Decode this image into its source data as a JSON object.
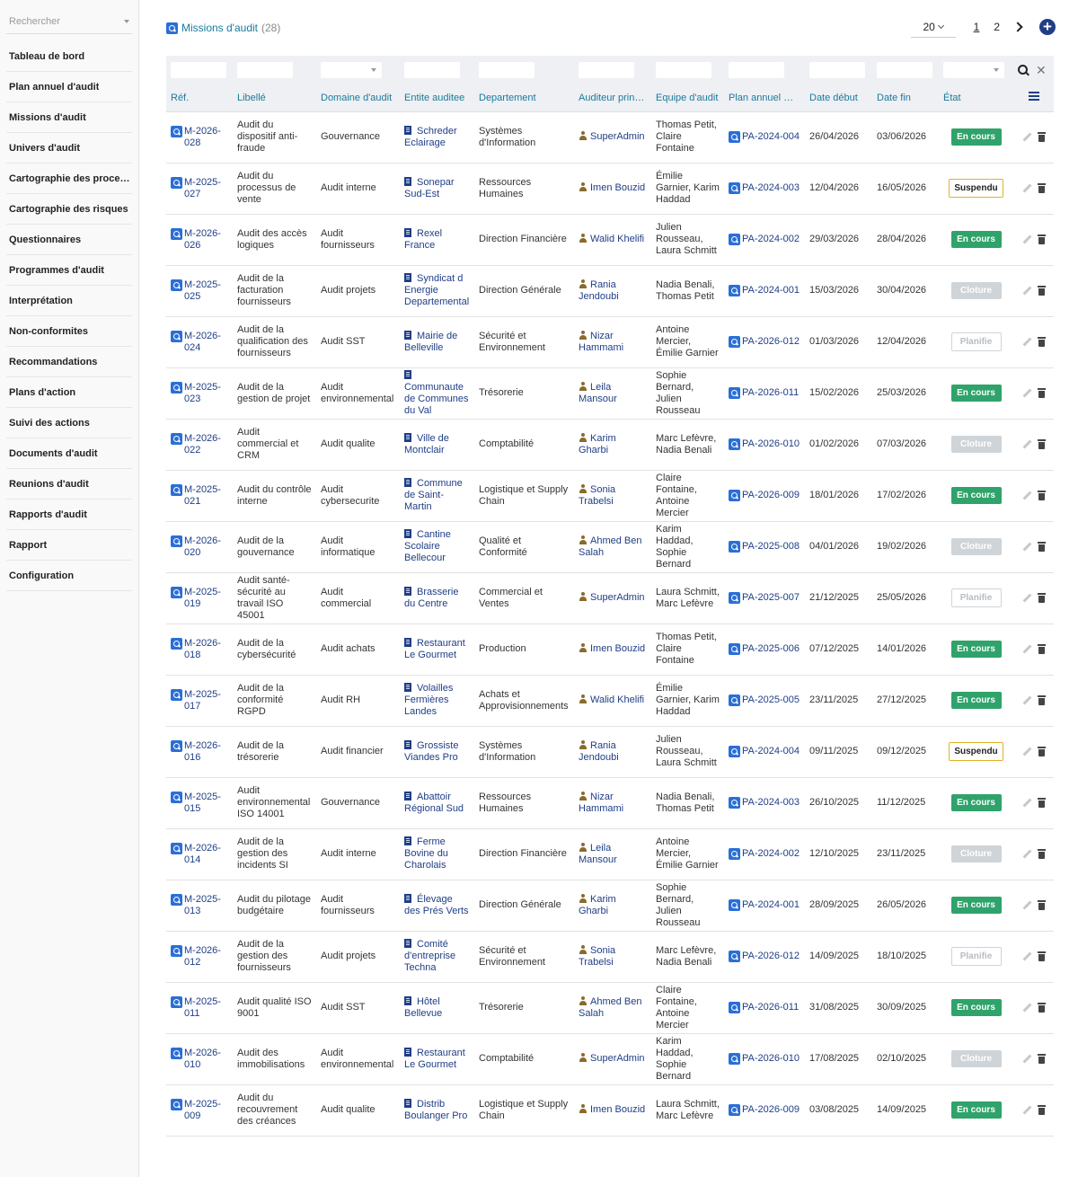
{
  "sidebar": {
    "search_placeholder": "Rechercher",
    "items": [
      {
        "label": "Tableau de bord"
      },
      {
        "label": "Plan annuel d'audit"
      },
      {
        "label": "Missions d'audit"
      },
      {
        "label": "Univers d'audit"
      },
      {
        "label": "Cartographie des proce…"
      },
      {
        "label": "Cartographie des risques"
      },
      {
        "label": "Questionnaires"
      },
      {
        "label": "Programmes d'audit"
      },
      {
        "label": "Interprétation"
      },
      {
        "label": "Non-conformites"
      },
      {
        "label": "Recommandations"
      },
      {
        "label": "Plans d'action"
      },
      {
        "label": "Suivi des actions"
      },
      {
        "label": "Documents d'audit"
      },
      {
        "label": "Reunions d'audit"
      },
      {
        "label": "Rapports d'audit"
      },
      {
        "label": "Rapport"
      },
      {
        "label": "Configuration"
      }
    ]
  },
  "header": {
    "title": "Missions d'audit",
    "count": "(28)",
    "page_size": "20",
    "pages": [
      "1",
      "2"
    ]
  },
  "table": {
    "columns": [
      "Réf.",
      "Libellé",
      "Domaine d'audit",
      "Entite auditee",
      "Departement",
      "Auditeur prin…",
      "Equipe d'audit",
      "Plan annuel …",
      "Date début",
      "Date fin",
      "État"
    ],
    "rows": [
      {
        "ref": "M-2026-028",
        "libelle": "Audit du dispositif anti-fraude",
        "domaine": "Gouvernance",
        "entite": "Schreder Eclairage",
        "departement": "Systèmes d'Information",
        "auditeur": "SuperAdmin",
        "equipe": "Thomas Petit, Claire Fontaine",
        "plan": "PA-2024-004",
        "debut": "26/04/2026",
        "fin": "03/06/2026",
        "etat": "En cours",
        "etat_key": "encours"
      },
      {
        "ref": "M-2025-027",
        "libelle": "Audit du processus de vente",
        "domaine": "Audit interne",
        "entite": "Sonepar Sud-Est",
        "departement": "Ressources Humaines",
        "auditeur": "Imen Bouzid",
        "equipe": "Émilie Garnier, Karim Haddad",
        "plan": "PA-2024-003",
        "debut": "12/04/2026",
        "fin": "16/05/2026",
        "etat": "Suspendu",
        "etat_key": "suspendu"
      },
      {
        "ref": "M-2026-026",
        "libelle": "Audit des accès logiques",
        "domaine": "Audit fournisseurs",
        "entite": "Rexel France",
        "departement": "Direction Financière",
        "auditeur": "Walid Khelifi",
        "equipe": "Julien Rousseau, Laura Schmitt",
        "plan": "PA-2024-002",
        "debut": "29/03/2026",
        "fin": "28/04/2026",
        "etat": "En cours",
        "etat_key": "encours"
      },
      {
        "ref": "M-2025-025",
        "libelle": "Audit de la facturation fournisseurs",
        "domaine": "Audit projets",
        "entite": "Syndicat d Energie Departemental",
        "departement": "Direction Générale",
        "auditeur": "Rania Jendoubi",
        "equipe": "Nadia Benali, Thomas Petit",
        "plan": "PA-2024-001",
        "debut": "15/03/2026",
        "fin": "30/04/2026",
        "etat": "Cloture",
        "etat_key": "cloture"
      },
      {
        "ref": "M-2026-024",
        "libelle": "Audit de la qualification des fournisseurs",
        "domaine": "Audit SST",
        "entite": "Mairie de Belleville",
        "departement": "Sécurité et Environnement",
        "auditeur": "Nizar Hammami",
        "equipe": "Antoine Mercier, Émilie Garnier",
        "plan": "PA-2026-012",
        "debut": "01/03/2026",
        "fin": "12/04/2026",
        "etat": "Planifie",
        "etat_key": "planifie"
      },
      {
        "ref": "M-2025-023",
        "libelle": "Audit de la gestion de projet",
        "domaine": "Audit environnemental",
        "entite": "Communaute de Communes du Val",
        "departement": "Trésorerie",
        "auditeur": "Leila Mansour",
        "equipe": "Sophie Bernard, Julien Rousseau",
        "plan": "PA-2026-011",
        "debut": "15/02/2026",
        "fin": "25/03/2026",
        "etat": "En cours",
        "etat_key": "encours"
      },
      {
        "ref": "M-2026-022",
        "libelle": "Audit commercial et CRM",
        "domaine": "Audit qualite",
        "entite": "Ville de Montclair",
        "departement": "Comptabilité",
        "auditeur": "Karim Gharbi",
        "equipe": "Marc Lefèvre, Nadia Benali",
        "plan": "PA-2026-010",
        "debut": "01/02/2026",
        "fin": "07/03/2026",
        "etat": "Cloture",
        "etat_key": "cloture"
      },
      {
        "ref": "M-2025-021",
        "libelle": "Audit du contrôle interne",
        "domaine": "Audit cybersecurite",
        "entite": "Commune de Saint-Martin",
        "departement": "Logistique et Supply Chain",
        "auditeur": "Sonia Trabelsi",
        "equipe": "Claire Fontaine, Antoine Mercier",
        "plan": "PA-2026-009",
        "debut": "18/01/2026",
        "fin": "17/02/2026",
        "etat": "En cours",
        "etat_key": "encours"
      },
      {
        "ref": "M-2026-020",
        "libelle": "Audit de la gouvernance",
        "domaine": "Audit informatique",
        "entite": "Cantine Scolaire Bellecour",
        "departement": "Qualité et Conformité",
        "auditeur": "Ahmed Ben Salah",
        "equipe": "Karim Haddad, Sophie Bernard",
        "plan": "PA-2025-008",
        "debut": "04/01/2026",
        "fin": "19/02/2026",
        "etat": "Cloture",
        "etat_key": "cloture"
      },
      {
        "ref": "M-2025-019",
        "libelle": "Audit santé-sécurité au travail ISO 45001",
        "domaine": "Audit commercial",
        "entite": "Brasserie du Centre",
        "departement": "Commercial et Ventes",
        "auditeur": "SuperAdmin",
        "equipe": "Laura Schmitt, Marc Lefèvre",
        "plan": "PA-2025-007",
        "debut": "21/12/2025",
        "fin": "25/05/2026",
        "etat": "Planifie",
        "etat_key": "planifie"
      },
      {
        "ref": "M-2026-018",
        "libelle": "Audit de la cybersécurité",
        "domaine": "Audit achats",
        "entite": "Restaurant Le Gourmet",
        "departement": "Production",
        "auditeur": "Imen Bouzid",
        "equipe": "Thomas Petit, Claire Fontaine",
        "plan": "PA-2025-006",
        "debut": "07/12/2025",
        "fin": "14/01/2026",
        "etat": "En cours",
        "etat_key": "encours"
      },
      {
        "ref": "M-2025-017",
        "libelle": "Audit de la conformité RGPD",
        "domaine": "Audit RH",
        "entite": "Volailles Fermières Landes",
        "departement": "Achats et Approvisionnements",
        "auditeur": "Walid Khelifi",
        "equipe": "Émilie Garnier, Karim Haddad",
        "plan": "PA-2025-005",
        "debut": "23/11/2025",
        "fin": "27/12/2025",
        "etat": "En cours",
        "etat_key": "encours"
      },
      {
        "ref": "M-2026-016",
        "libelle": "Audit de la trésorerie",
        "domaine": "Audit financier",
        "entite": "Grossiste Viandes Pro",
        "departement": "Systèmes d'Information",
        "auditeur": "Rania Jendoubi",
        "equipe": "Julien Rousseau, Laura Schmitt",
        "plan": "PA-2024-004",
        "debut": "09/11/2025",
        "fin": "09/12/2025",
        "etat": "Suspendu",
        "etat_key": "suspendu"
      },
      {
        "ref": "M-2025-015",
        "libelle": "Audit environnemental ISO 14001",
        "domaine": "Gouvernance",
        "entite": "Abattoir Régional Sud",
        "departement": "Ressources Humaines",
        "auditeur": "Nizar Hammami",
        "equipe": "Nadia Benali, Thomas Petit",
        "plan": "PA-2024-003",
        "debut": "26/10/2025",
        "fin": "11/12/2025",
        "etat": "En cours",
        "etat_key": "encours"
      },
      {
        "ref": "M-2026-014",
        "libelle": "Audit de la gestion des incidents SI",
        "domaine": "Audit interne",
        "entite": "Ferme Bovine du Charolais",
        "departement": "Direction Financière",
        "auditeur": "Leila Mansour",
        "equipe": "Antoine Mercier, Émilie Garnier",
        "plan": "PA-2024-002",
        "debut": "12/10/2025",
        "fin": "23/11/2025",
        "etat": "Cloture",
        "etat_key": "cloture"
      },
      {
        "ref": "M-2025-013",
        "libelle": "Audit du pilotage budgétaire",
        "domaine": "Audit fournisseurs",
        "entite": "Élevage des Prés Verts",
        "departement": "Direction Générale",
        "auditeur": "Karim Gharbi",
        "equipe": "Sophie Bernard, Julien Rousseau",
        "plan": "PA-2024-001",
        "debut": "28/09/2025",
        "fin": "26/05/2026",
        "etat": "En cours",
        "etat_key": "encours"
      },
      {
        "ref": "M-2026-012",
        "libelle": "Audit de la gestion des fournisseurs",
        "domaine": "Audit projets",
        "entite": "Comité d'entreprise Techna",
        "departement": "Sécurité et Environnement",
        "auditeur": "Sonia Trabelsi",
        "equipe": "Marc Lefèvre, Nadia Benali",
        "plan": "PA-2026-012",
        "debut": "14/09/2025",
        "fin": "18/10/2025",
        "etat": "Planifie",
        "etat_key": "planifie"
      },
      {
        "ref": "M-2025-011",
        "libelle": "Audit qualité ISO 9001",
        "domaine": "Audit SST",
        "entite": "Hôtel Bellevue",
        "departement": "Trésorerie",
        "auditeur": "Ahmed Ben Salah",
        "equipe": "Claire Fontaine, Antoine Mercier",
        "plan": "PA-2026-011",
        "debut": "31/08/2025",
        "fin": "30/09/2025",
        "etat": "En cours",
        "etat_key": "encours"
      },
      {
        "ref": "M-2026-010",
        "libelle": "Audit des immobilisations",
        "domaine": "Audit environnemental",
        "entite": "Restaurant Le Gourmet",
        "departement": "Comptabilité",
        "auditeur": "SuperAdmin",
        "equipe": "Karim Haddad, Sophie Bernard",
        "plan": "PA-2026-010",
        "debut": "17/08/2025",
        "fin": "02/10/2025",
        "etat": "Cloture",
        "etat_key": "cloture"
      },
      {
        "ref": "M-2025-009",
        "libelle": "Audit du recouvrement des créances",
        "domaine": "Audit qualite",
        "entite": "Distrib Boulanger Pro",
        "departement": "Logistique et Supply Chain",
        "auditeur": "Imen Bouzid",
        "equipe": "Laura Schmitt, Marc Lefèvre",
        "plan": "PA-2026-009",
        "debut": "03/08/2025",
        "fin": "14/09/2025",
        "etat": "En cours",
        "etat_key": "encours"
      }
    ]
  }
}
